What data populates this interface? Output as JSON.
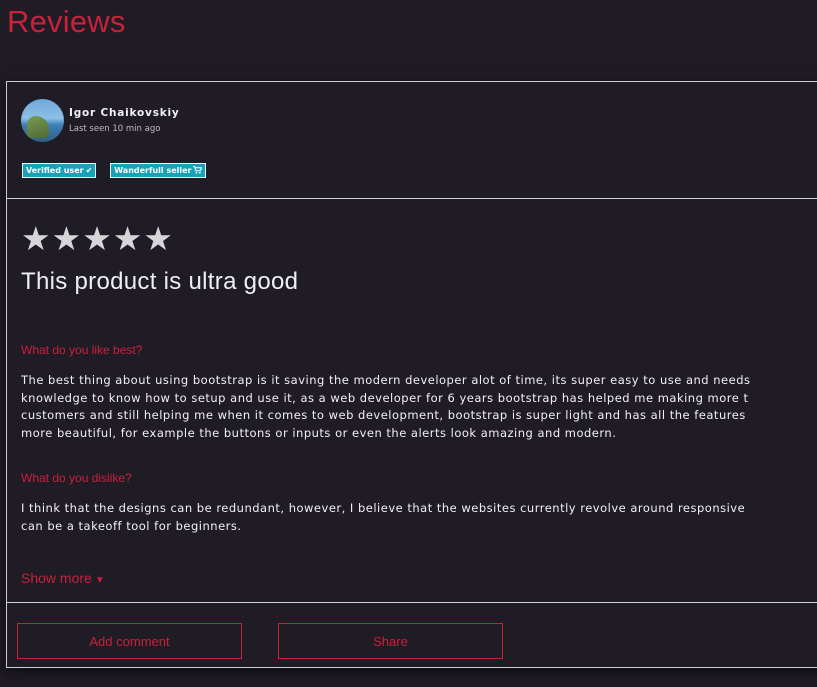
{
  "page": {
    "title": "Reviews"
  },
  "review": {
    "user": {
      "name": "Igor Chaikovskiy",
      "last_seen": "Last seen 10 min ago"
    },
    "badges": [
      {
        "label": "Verified user",
        "icon": "check-icon"
      },
      {
        "label": "Wanderfull seller",
        "icon": "cart-icon"
      }
    ],
    "rating": 5,
    "stars": [
      "★",
      "★",
      "★",
      "★",
      "★"
    ],
    "title": "This product is ultra good",
    "questions": [
      {
        "label": "What do you like best?",
        "lines": [
          "The best thing about using bootstrap is it saving the modern developer alot of time, its super easy to use and needs",
          "knowledge to know how to setup and use it, as a web developer for 6 years bootstrap has helped me making more t",
          "customers and still helping me when it comes to web development, bootstrap is super light and has all the features",
          "more beautiful, for example the buttons or inputs or even the alerts look amazing and modern."
        ]
      },
      {
        "label": "What do you dislike?",
        "lines": [
          "I think that the designs can be redundant, however, I believe that the websites currently revolve around responsive",
          "can be a takeoff tool for beginners."
        ]
      }
    ],
    "show_more": "Show more",
    "actions": {
      "add_comment": "Add comment",
      "share": "Share"
    }
  },
  "colors": {
    "accent": "#c8213a",
    "badge": "#17a2b8",
    "background": "#201c26"
  }
}
